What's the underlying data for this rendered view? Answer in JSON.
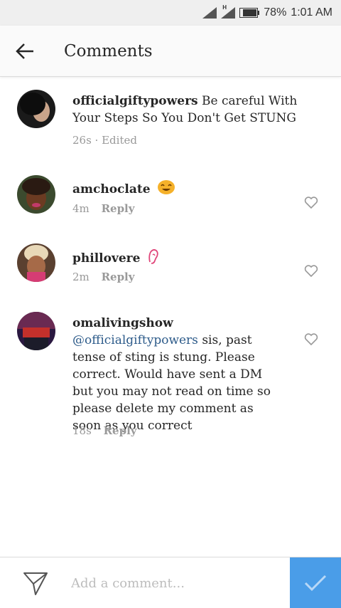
{
  "status_bar": {
    "battery": "78%",
    "time": "1:01 AM",
    "network": "H"
  },
  "header": {
    "title": "Comments",
    "back_icon": "arrow-left-icon"
  },
  "comments": [
    {
      "username": "officialgiftypowers",
      "text": "Be careful With Your Steps So You Don't Get STUNG",
      "time": "26s · Edited",
      "reply_label": ""
    },
    {
      "username": "amchoclate",
      "emoji": "smiling-face-icon",
      "time": "4m",
      "reply_label": "Reply"
    },
    {
      "username": "phillovere",
      "emoji": "ear-icon",
      "time": "2m",
      "reply_label": "Reply"
    },
    {
      "username": "omalivingshow",
      "mention": "@officialgiftypowers",
      "text": "sis, past tense of sting is stung. Please correct. Would have sent a DM but you may not read on time so please delete my comment as soon as you correct",
      "time": "18s",
      "reply_label": "Reply"
    }
  ],
  "composer": {
    "placeholder": "Add a comment...",
    "send_icon": "paper-plane-icon",
    "post_icon": "checkmark-icon"
  },
  "colors": {
    "accent": "#4a9de8",
    "mention": "#2d5b8a",
    "meta": "#999999"
  }
}
